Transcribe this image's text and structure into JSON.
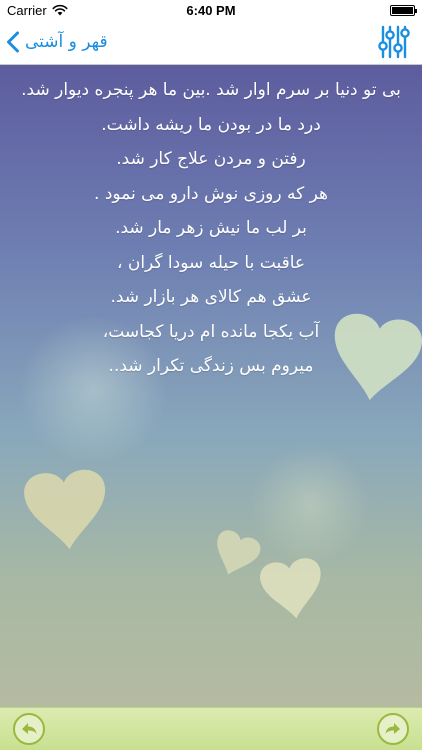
{
  "status_bar": {
    "carrier": "Carrier",
    "time": "6:40 PM",
    "icons": [
      "wifi-icon",
      "battery-icon"
    ]
  },
  "nav": {
    "back_label": "قهر و آشتی",
    "back_icon": "chevron-left-icon",
    "settings_icon": "equalizer-sliders-icon"
  },
  "poem": {
    "lines": [
      "بی تو دنیا بر سرم اوار شد .بین ما هر پنجره دیوار شد.",
      "درد ما در بودن ما ریشه داشت.",
      "رفتن و مردن علاج کار شد.",
      "هر که روزی نوش دارو می نمود .",
      "بر لب ما نیش زهر مار شد.",
      "عاقبت با حیله سودا گران ،",
      "عشق هم کالای هر بازار شد.",
      "آب یکجا مانده ام دریا کجاست،",
      "میروم بس زندگی تکرار شد.."
    ]
  },
  "toolbar": {
    "prev_icon": "arrow-back-icon",
    "next_icon": "arrow-forward-icon"
  },
  "colors": {
    "accent": "#1a8ee0",
    "text": "#ffffff",
    "toolbar_bg": "#d4e7a4",
    "toolbar_button_border": "#9ab83e"
  }
}
